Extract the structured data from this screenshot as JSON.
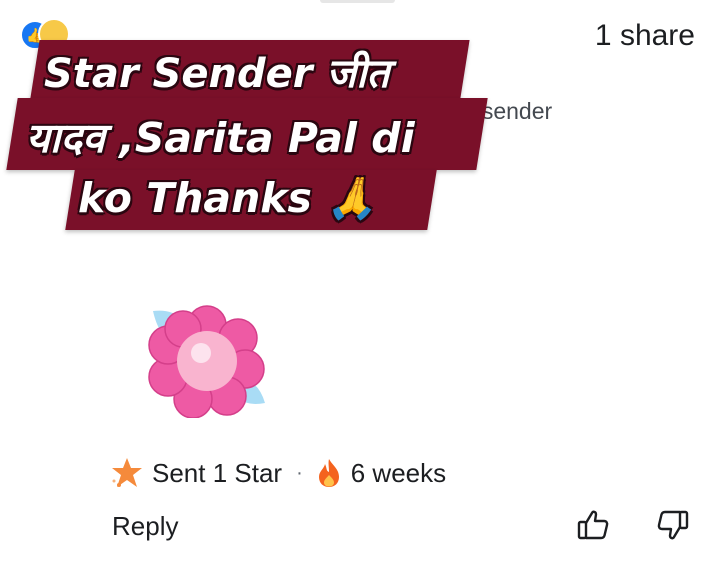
{
  "header": {
    "share_count": "1 share"
  },
  "comment": {
    "partial_text": "ar sender"
  },
  "overlay_caption": {
    "line1": "Star Sender जीत",
    "line2": "यादव ,Sarita Pal di",
    "line3": "ko Thanks 🙏"
  },
  "sticker": {
    "icon": "flower-sticker-icon"
  },
  "meta": {
    "star_label": "Sent 1 Star",
    "separator": "·",
    "time_label": "6 weeks"
  },
  "actions": {
    "reply_label": "Reply"
  },
  "colors": {
    "banner": "#7a1029",
    "star": "#f58a3b",
    "flower": "#f05aa5"
  }
}
